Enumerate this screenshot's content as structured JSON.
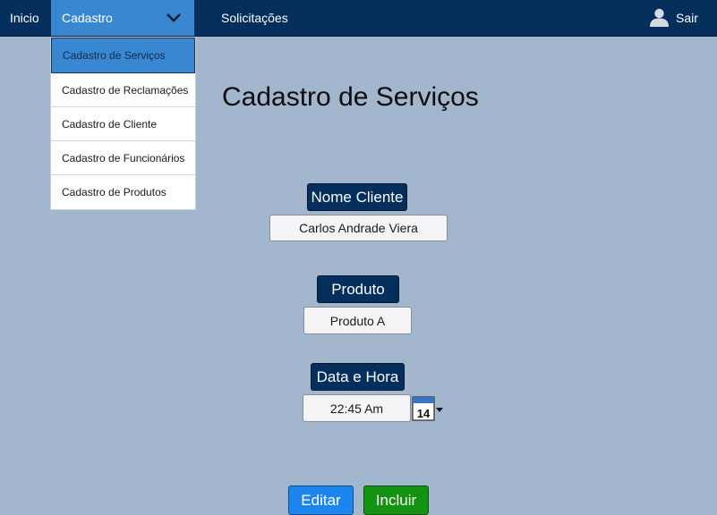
{
  "nav": {
    "inicio": "Inicio",
    "cadastro": "Cadastro",
    "solicitacoes": "Solicitações",
    "sair": "Sair",
    "icons": {
      "dropdown": "chevron-down-icon",
      "user": "user-icon"
    }
  },
  "dropdown": {
    "items": [
      {
        "label": "Cadastro de Serviços",
        "active": true
      },
      {
        "label": "Cadastro de Reclamações",
        "active": false
      },
      {
        "label": "Cadastro de Cliente",
        "active": false
      },
      {
        "label": "Cadastro de Funcionários",
        "active": false
      },
      {
        "label": "Cadastro de Produtos",
        "active": false
      }
    ]
  },
  "page": {
    "title": "Cadastro de Serviços"
  },
  "form": {
    "nome_cliente": {
      "label": "Nome Cliente",
      "value": "Carlos Andrade Viera"
    },
    "produto": {
      "label": "Produto",
      "value": "Produto A"
    },
    "data_hora": {
      "label": "Data e Hora",
      "value": "22:45 Am",
      "calendar_day": "14"
    }
  },
  "buttons": {
    "editar": "Editar",
    "incluir": "Incluir"
  },
  "colors": {
    "background": "#a2b6cd",
    "topbar": "#042f5d",
    "accent": "#3a87d1",
    "editar": "#1c86ee",
    "incluir": "#149312"
  }
}
